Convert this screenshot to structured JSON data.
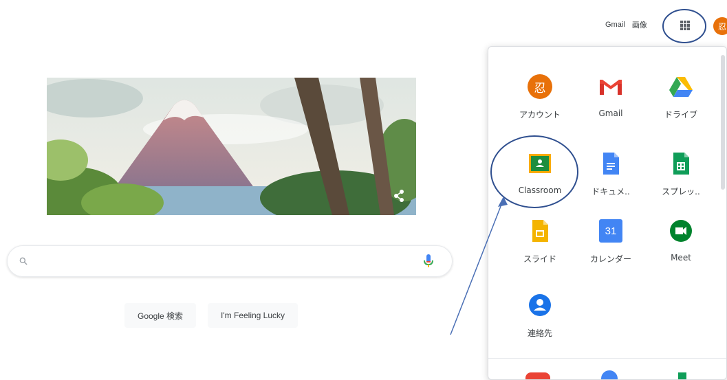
{
  "header": {
    "links": [
      {
        "label": "Gmail"
      },
      {
        "label": "画像"
      }
    ],
    "avatar_letter": "忍"
  },
  "search": {
    "value": "",
    "placeholder": ""
  },
  "buttons": {
    "search_label": "Google 検索",
    "lucky_label": "I'm Feeling Lucky"
  },
  "apps_panel": {
    "items": [
      {
        "label": "アカウント",
        "icon": "account-icon",
        "glyph": "忍"
      },
      {
        "label": "Gmail",
        "icon": "gmail-icon"
      },
      {
        "label": "ドライブ",
        "icon": "drive-icon"
      },
      {
        "label": "Classroom",
        "icon": "classroom-icon"
      },
      {
        "label": "ドキュメ..",
        "icon": "docs-icon"
      },
      {
        "label": "スプレッ..",
        "icon": "sheets-icon"
      },
      {
        "label": "スライド",
        "icon": "slides-icon"
      },
      {
        "label": "カレンダー",
        "icon": "calendar-icon",
        "glyph": "31"
      },
      {
        "label": "Meet",
        "icon": "meet-icon"
      },
      {
        "label": "連絡先",
        "icon": "contacts-icon"
      }
    ]
  },
  "colors": {
    "accent_orange": "#e8710a",
    "annotation_blue": "#2f4f8f",
    "google_blue": "#4285f4",
    "google_red": "#ea4335",
    "google_yellow": "#fbbc04",
    "google_green": "#34a853"
  }
}
